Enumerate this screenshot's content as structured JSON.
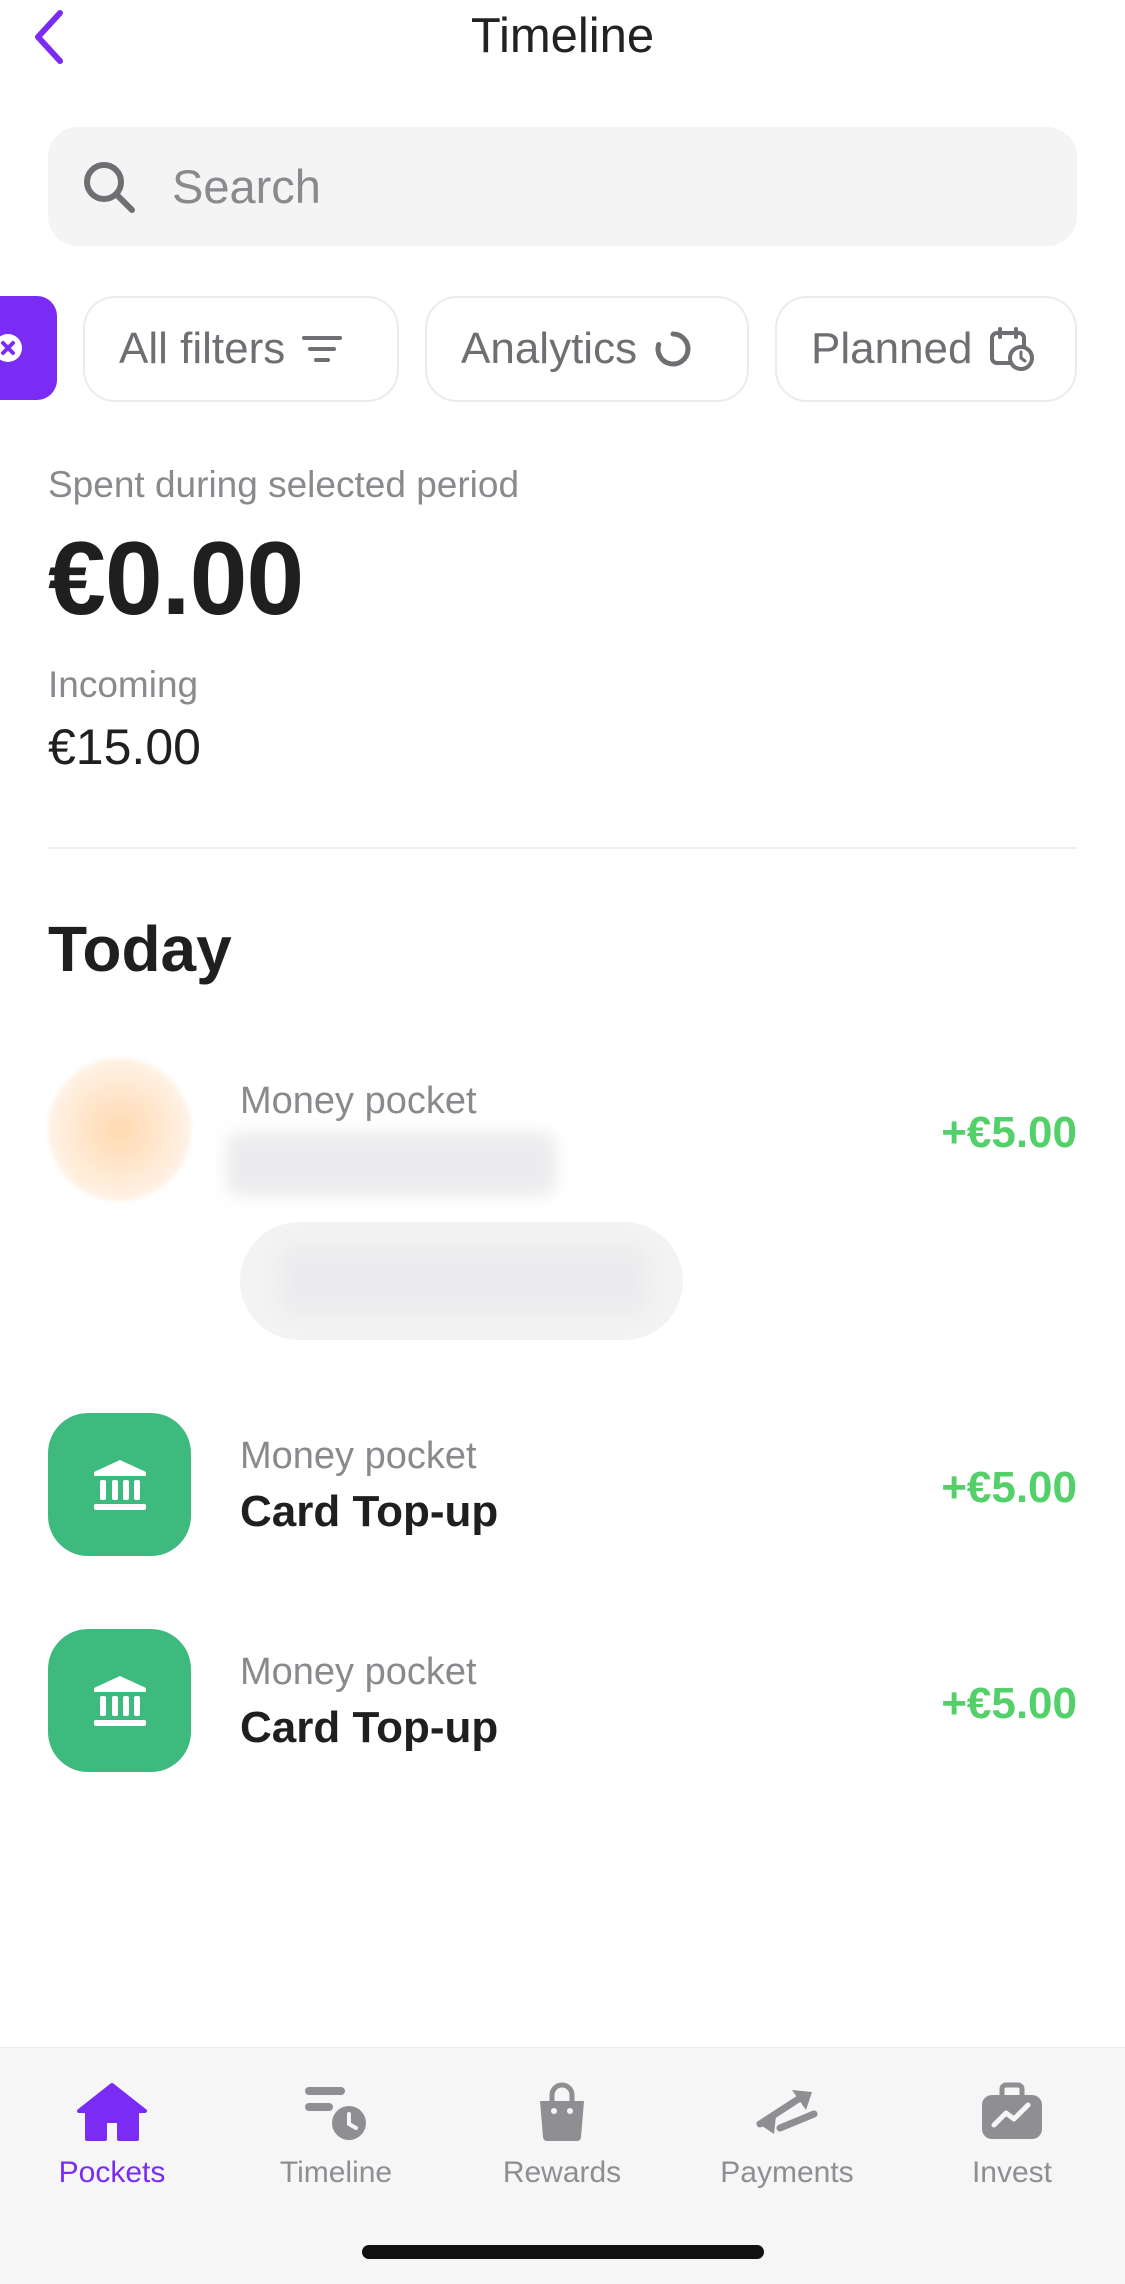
{
  "header": {
    "title": "Timeline",
    "back_icon": "chevron-left-icon"
  },
  "search": {
    "placeholder": "Search",
    "icon": "search-icon"
  },
  "filters": {
    "accent_chip_icon": "close-icon",
    "chips": [
      {
        "label": "All filters",
        "icon": "filter-lines-icon"
      },
      {
        "label": "Analytics",
        "icon": "circular-progress-icon"
      },
      {
        "label": "Planned",
        "icon": "calendar-clock-icon"
      }
    ]
  },
  "summary": {
    "spent_label": "Spent during selected period",
    "spent_amount": "€0.00",
    "incoming_label": "Incoming",
    "incoming_amount": "€15.00"
  },
  "section": {
    "title": "Today"
  },
  "transactions": [
    {
      "subtitle": "Money pocket",
      "title": "",
      "amount": "+€5.00",
      "icon": "blurred-avatar",
      "redacted": true
    },
    {
      "subtitle": "Money pocket",
      "title": "Card Top-up",
      "amount": "+€5.00",
      "icon": "bank-icon"
    },
    {
      "subtitle": "Money pocket",
      "title": "Card Top-up",
      "amount": "+€5.00",
      "icon": "bank-icon"
    }
  ],
  "tabbar": {
    "tabs": [
      {
        "label": "Pockets",
        "icon": "home-icon",
        "active": true
      },
      {
        "label": "Timeline",
        "icon": "timeline-icon",
        "active": false
      },
      {
        "label": "Rewards",
        "icon": "shopping-bag-icon",
        "active": false
      },
      {
        "label": "Payments",
        "icon": "transfer-arrows-icon",
        "active": false
      },
      {
        "label": "Invest",
        "icon": "briefcase-chart-icon",
        "active": false
      }
    ]
  },
  "colors": {
    "accent": "#7a2cf5",
    "positive_amount": "#54d06a",
    "bank_icon_bg": "#3fba7e",
    "muted_text": "#8a8a8e"
  }
}
